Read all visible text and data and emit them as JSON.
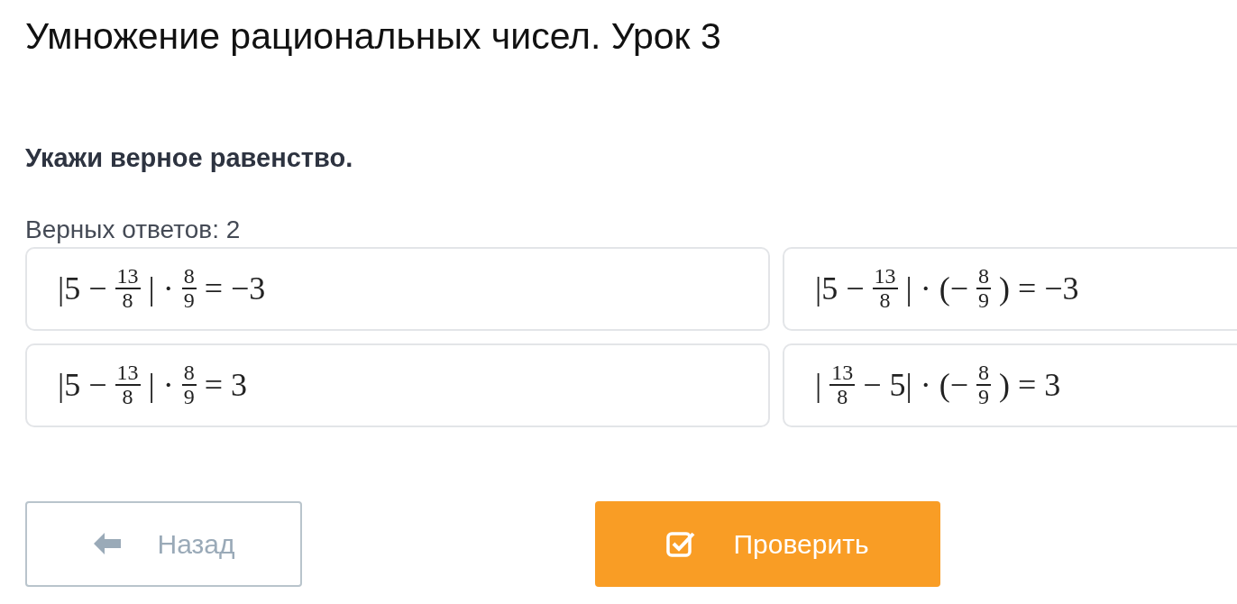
{
  "title": "Умножение рациональных чисел. Урок 3",
  "question": "Укажи верное равенство.",
  "answers_count": "Верных ответов: 2",
  "options": [
    {
      "selected": false,
      "parts": [
        {
          "kind": "text",
          "text": "|5 −"
        },
        {
          "kind": "frac",
          "num": "13",
          "den": "8"
        },
        {
          "kind": "text",
          "text": "| ·"
        },
        {
          "kind": "frac",
          "num": "8",
          "den": "9"
        },
        {
          "kind": "text",
          "text": "= −3"
        }
      ]
    },
    {
      "selected": false,
      "parts": [
        {
          "kind": "text",
          "text": "|5 −"
        },
        {
          "kind": "frac",
          "num": "13",
          "den": "8"
        },
        {
          "kind": "text",
          "text": "| · (−"
        },
        {
          "kind": "frac",
          "num": "8",
          "den": "9"
        },
        {
          "kind": "text",
          "text": ") = −3"
        }
      ]
    },
    {
      "selected": false,
      "parts": [
        {
          "kind": "text",
          "text": "|5 −"
        },
        {
          "kind": "frac",
          "num": "13",
          "den": "8"
        },
        {
          "kind": "text",
          "text": "| ·"
        },
        {
          "kind": "frac",
          "num": "8",
          "den": "9"
        },
        {
          "kind": "text",
          "text": "= 3"
        }
      ]
    },
    {
      "selected": false,
      "parts": [
        {
          "kind": "text",
          "text": "|"
        },
        {
          "kind": "frac",
          "num": "13",
          "den": "8"
        },
        {
          "kind": "text",
          "text": "− 5| · (−"
        },
        {
          "kind": "frac",
          "num": "8",
          "den": "9"
        },
        {
          "kind": "text",
          "text": ") = 3"
        }
      ]
    }
  ],
  "buttons": {
    "back": "Назад",
    "check": "Проверить"
  }
}
